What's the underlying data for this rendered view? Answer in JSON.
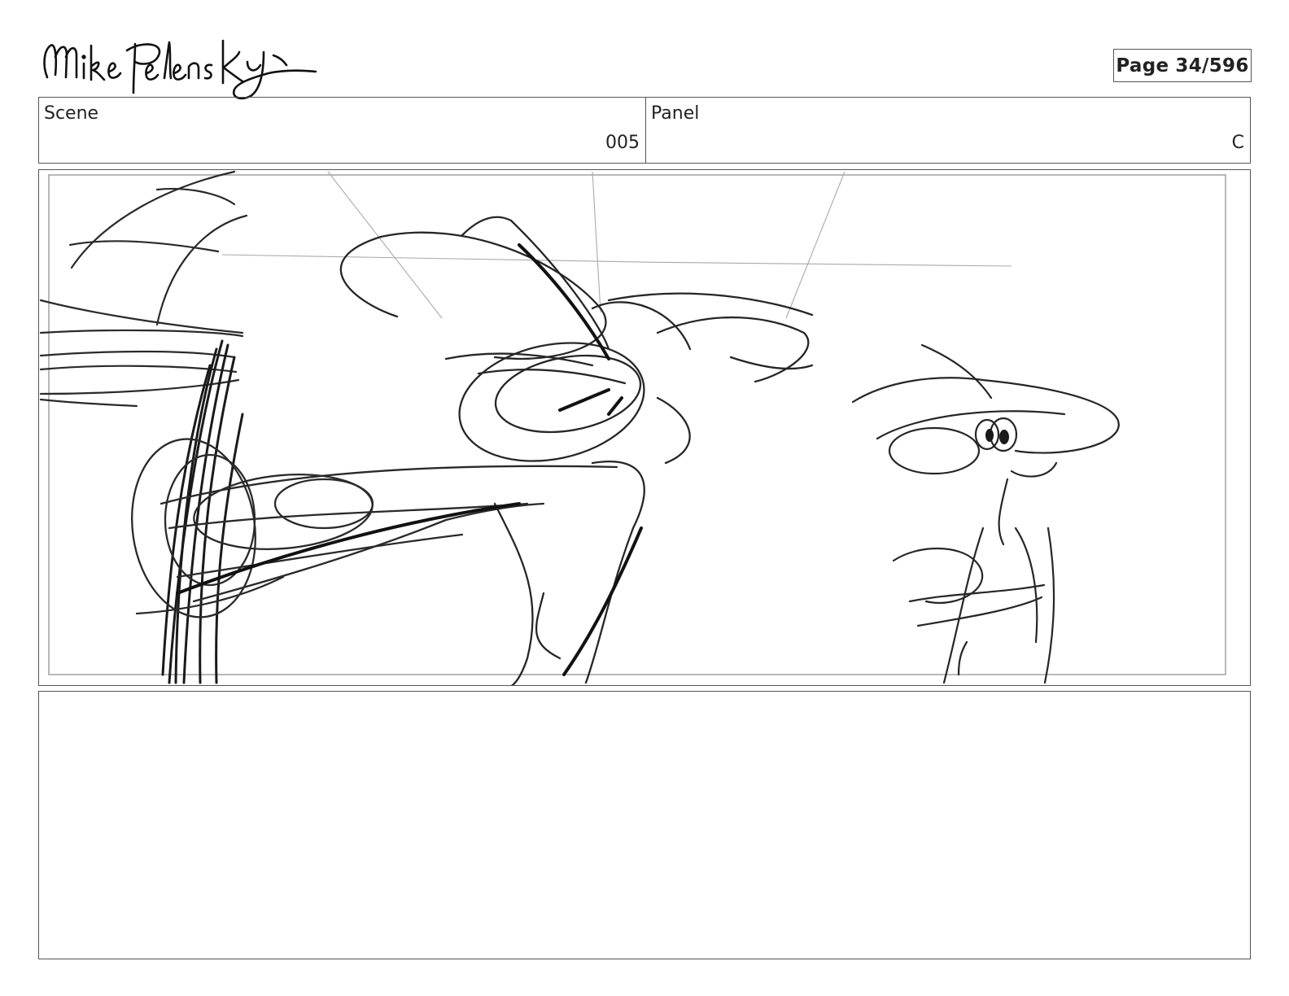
{
  "header": {
    "signature_text": "Mike Pelensky",
    "page_label": "Page",
    "page_number": "34/596"
  },
  "info": {
    "scene_label": "Scene",
    "scene_value": "005",
    "panel_label": "Panel",
    "panel_value": "C"
  },
  "notes": {
    "text": ""
  }
}
